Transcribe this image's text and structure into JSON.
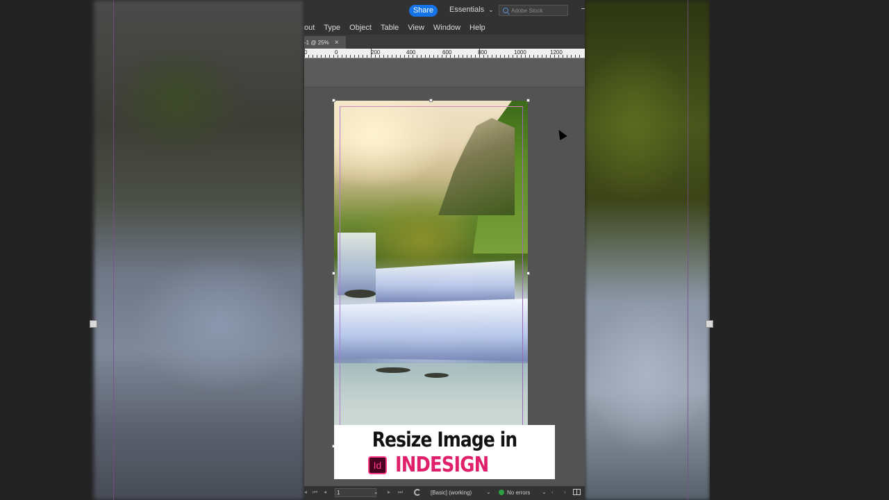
{
  "topbar": {
    "share_label": "Share",
    "workspace_label": "Essentials",
    "stock_search_placeholder": "Adobe Stock"
  },
  "menubar": {
    "items": [
      "out",
      "Type",
      "Object",
      "Table",
      "View",
      "Window",
      "Help"
    ]
  },
  "document_tab": {
    "title": "-1 @ 25%"
  },
  "ruler": {
    "labels": [
      "0",
      "0",
      "200",
      "400",
      "600",
      "800",
      "1000",
      "1200"
    ]
  },
  "statusbar": {
    "page_value": "1",
    "profile": "[Basic] (working)",
    "preflight": "No errors"
  },
  "caption": {
    "title": "Resize Image in",
    "brand": "INDESIGN",
    "logo": "Id"
  },
  "colors": {
    "share_blue": "#1473e6",
    "indesign_pink": "#e0206a",
    "indesign_logo_bg": "#49021f",
    "status_green": "#2ea043"
  }
}
